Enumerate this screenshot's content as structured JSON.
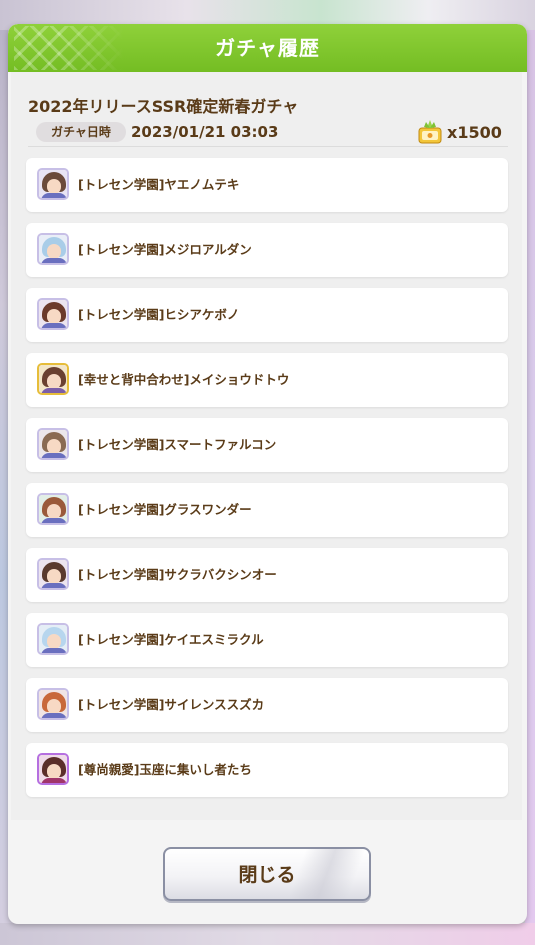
{
  "dialog": {
    "title": "ガチャ履歴",
    "header_color": "#7cc42b"
  },
  "gacha": {
    "name": "2022年リリースSSR確定新春ガチャ",
    "date_label": "ガチャ日時",
    "date_value": "2023/01/21 03:03",
    "ticket_icon": "carrot-jewel-icon",
    "cost": "x1500"
  },
  "history": [
    {
      "name": "[トレセン学園]ヤエノムテキ",
      "frame": "silver",
      "hair": "#6b4a3a",
      "bg": "#e9e4f4",
      "cloth": "#6a6fbf"
    },
    {
      "name": "[トレセン学園]メジロアルダン",
      "frame": "silver",
      "hair": "#a9cde8",
      "bg": "#e9eef7",
      "cloth": "#6a6fbf"
    },
    {
      "name": "[トレセン学園]ヒシアケボノ",
      "frame": "silver",
      "hair": "#6b3a2a",
      "bg": "#ece4ef",
      "cloth": "#6a6fbf"
    },
    {
      "name": "[幸せと背中合わせ]メイショウドトウ",
      "frame": "gold",
      "hair": "#6a4030",
      "bg": "#f3e6c9",
      "cloth": "#7b5ea8"
    },
    {
      "name": "[トレセン学園]スマートファルコン",
      "frame": "silver",
      "hair": "#8a6a52",
      "bg": "#ece6ea",
      "cloth": "#6a6fbf"
    },
    {
      "name": "[トレセン学園]グラスワンダー",
      "frame": "silver",
      "hair": "#9a5a3a",
      "bg": "#e2eee6",
      "cloth": "#6a6fbf"
    },
    {
      "name": "[トレセン学園]サクラバクシンオー",
      "frame": "silver",
      "hair": "#5a3a2e",
      "bg": "#ece4ef",
      "cloth": "#6a6fbf"
    },
    {
      "name": "[トレセン学園]ケイエスミラクル",
      "frame": "silver",
      "hair": "#b7d6ee",
      "bg": "#e5eef6",
      "cloth": "#6a6fbf"
    },
    {
      "name": "[トレセン学園]サイレンススズカ",
      "frame": "silver",
      "hair": "#c8683a",
      "bg": "#f0e4e4",
      "cloth": "#6a6fbf"
    },
    {
      "name": "[尊尚親愛]玉座に集いし者たち",
      "frame": "rainbow",
      "hair": "#5a2e2a",
      "bg": "#efdbe8",
      "cloth": "#a0356a"
    }
  ],
  "footer": {
    "close_label": "閉じる"
  }
}
